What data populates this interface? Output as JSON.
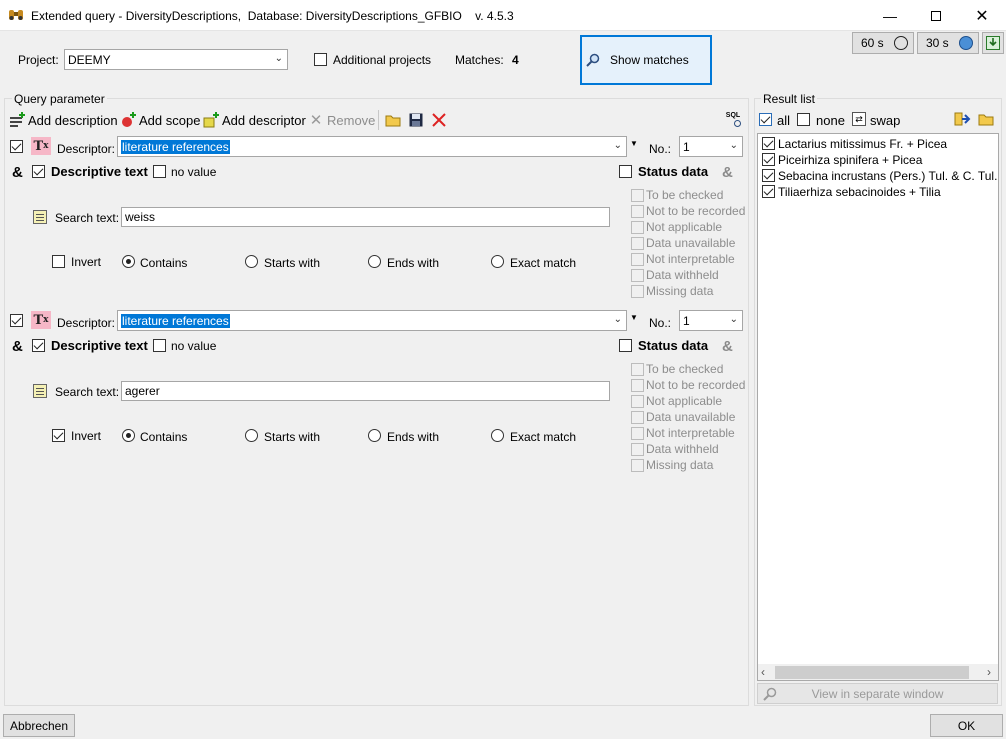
{
  "window": {
    "title": "Extended query - DiversityDescriptions,  Database: DiversityDescriptions_GFBIO    v. 4.5.3"
  },
  "project": {
    "label": "Project:",
    "value": "DEEMY",
    "additional_label": "Additional projects"
  },
  "matches": {
    "label": "Matches:",
    "count": "4"
  },
  "show_matches_label": "Show matches",
  "timers": {
    "t60": "60 s",
    "t30": "30 s"
  },
  "query": {
    "group_label": "Query parameter",
    "toolbar": {
      "add_description": "Add description",
      "add_scope": "Add scope",
      "add_descriptor": "Add descriptor",
      "remove": "Remove",
      "sql": "SQL"
    },
    "blocks": [
      {
        "descriptor_label": "Descriptor:",
        "descriptor_value": "literature references",
        "no_label": "No.:",
        "no_value": "1",
        "descriptive_text_label": "Descriptive text",
        "no_value_label": "no value",
        "search_label": "Search text:",
        "search_value": "weiss",
        "invert_label": "Invert",
        "invert_checked": false,
        "options": [
          "Contains",
          "Starts with",
          "Ends with",
          "Exact match"
        ],
        "status_label": "Status data",
        "status_items": [
          "To be checked",
          "Not to be recorded",
          "Not applicable",
          "Data unavailable",
          "Not interpretable",
          "Data withheld",
          "Missing data"
        ]
      },
      {
        "descriptor_label": "Descriptor:",
        "descriptor_value": "literature references",
        "no_label": "No.:",
        "no_value": "1",
        "descriptive_text_label": "Descriptive text",
        "no_value_label": "no value",
        "search_label": "Search text:",
        "search_value": "agerer",
        "invert_label": "Invert",
        "invert_checked": true,
        "options": [
          "Contains",
          "Starts with",
          "Ends with",
          "Exact match"
        ],
        "status_label": "Status data",
        "status_items": [
          "To be checked",
          "Not to be recorded",
          "Not applicable",
          "Data unavailable",
          "Not interpretable",
          "Data withheld",
          "Missing data"
        ]
      }
    ]
  },
  "results": {
    "group_label": "Result list",
    "all_label": "all",
    "none_label": "none",
    "swap_label": "swap",
    "items": [
      "Lactarius mitissimus Fr. + Picea",
      "Piceirhiza spinifera + Picea",
      "Sebacina incrustans (Pers.) Tul. & C. Tul. + Picea",
      "Tiliaerhiza sebacinoides + Tilia"
    ],
    "view_separate": "View in separate window"
  },
  "buttons": {
    "cancel": "Abbrechen",
    "ok": "OK"
  }
}
